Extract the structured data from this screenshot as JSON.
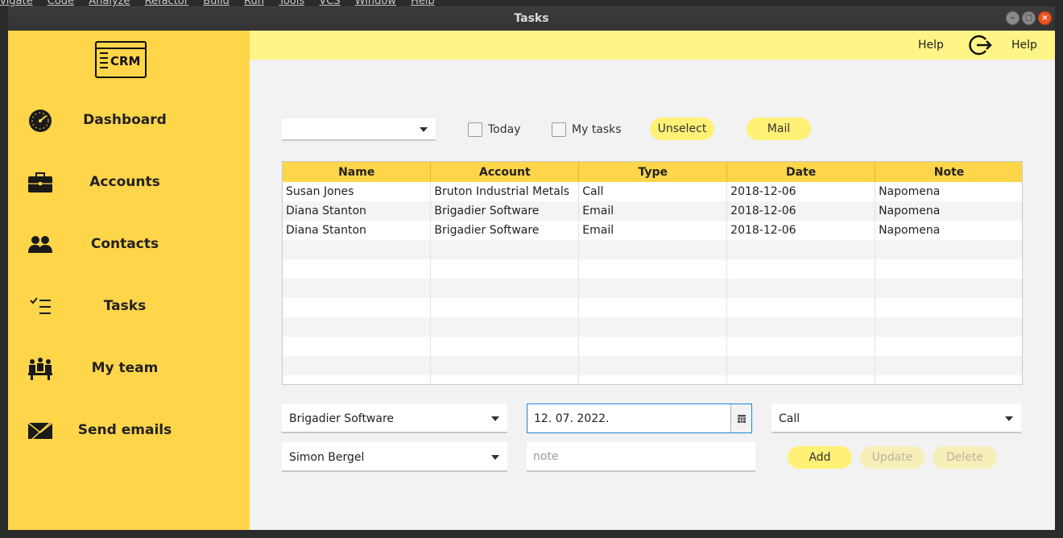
{
  "window": {
    "title": "Tasks"
  },
  "ide_menu": [
    "vigate",
    "Code",
    "Analyze",
    "Refactor",
    "Build",
    "Run",
    "Tools",
    "VCS",
    "Window",
    "Help"
  ],
  "sidebar": {
    "logo_text": "CRM",
    "items": [
      {
        "label": "Dashboard",
        "icon": "speedometer-icon"
      },
      {
        "label": "Accounts",
        "icon": "briefcase-icon"
      },
      {
        "label": "Contacts",
        "icon": "people-icon"
      },
      {
        "label": "Tasks",
        "icon": "checklist-icon"
      },
      {
        "label": "My team",
        "icon": "team-icon"
      },
      {
        "label": "Send emails",
        "icon": "email-icon"
      }
    ]
  },
  "topbar": {
    "help_left": "Help",
    "help_right": "Help",
    "logout_icon": "logout-icon"
  },
  "filters": {
    "account_combo_value": "",
    "today_label": "Today",
    "my_tasks_label": "My tasks",
    "unselect_label": "Unselect",
    "mail_label": "Mail"
  },
  "table": {
    "columns": [
      "Name",
      "Account",
      "Type",
      "Date",
      "Note"
    ],
    "rows": [
      [
        "Susan Jones",
        "Bruton Industrial Metals",
        "Call",
        "2018-12-06",
        "Napomena"
      ],
      [
        "Diana Stanton",
        "Brigadier Software",
        "Email",
        "2018-12-06",
        "Napomena"
      ],
      [
        "Diana Stanton",
        "Brigadier Software",
        "Email",
        "2018-12-06",
        "Napomena"
      ]
    ]
  },
  "form": {
    "account_value": "Brigadier Software",
    "date_value": "12. 07. 2022.",
    "type_value": "Call",
    "contact_value": "Simon Bergel",
    "note_placeholder": "note",
    "add_label": "Add",
    "update_label": "Update",
    "delete_label": "Delete"
  },
  "colors": {
    "sidebar": "#ffd54a",
    "topbar": "#fff586",
    "pill": "#fff176",
    "focus": "#1e88d8"
  }
}
